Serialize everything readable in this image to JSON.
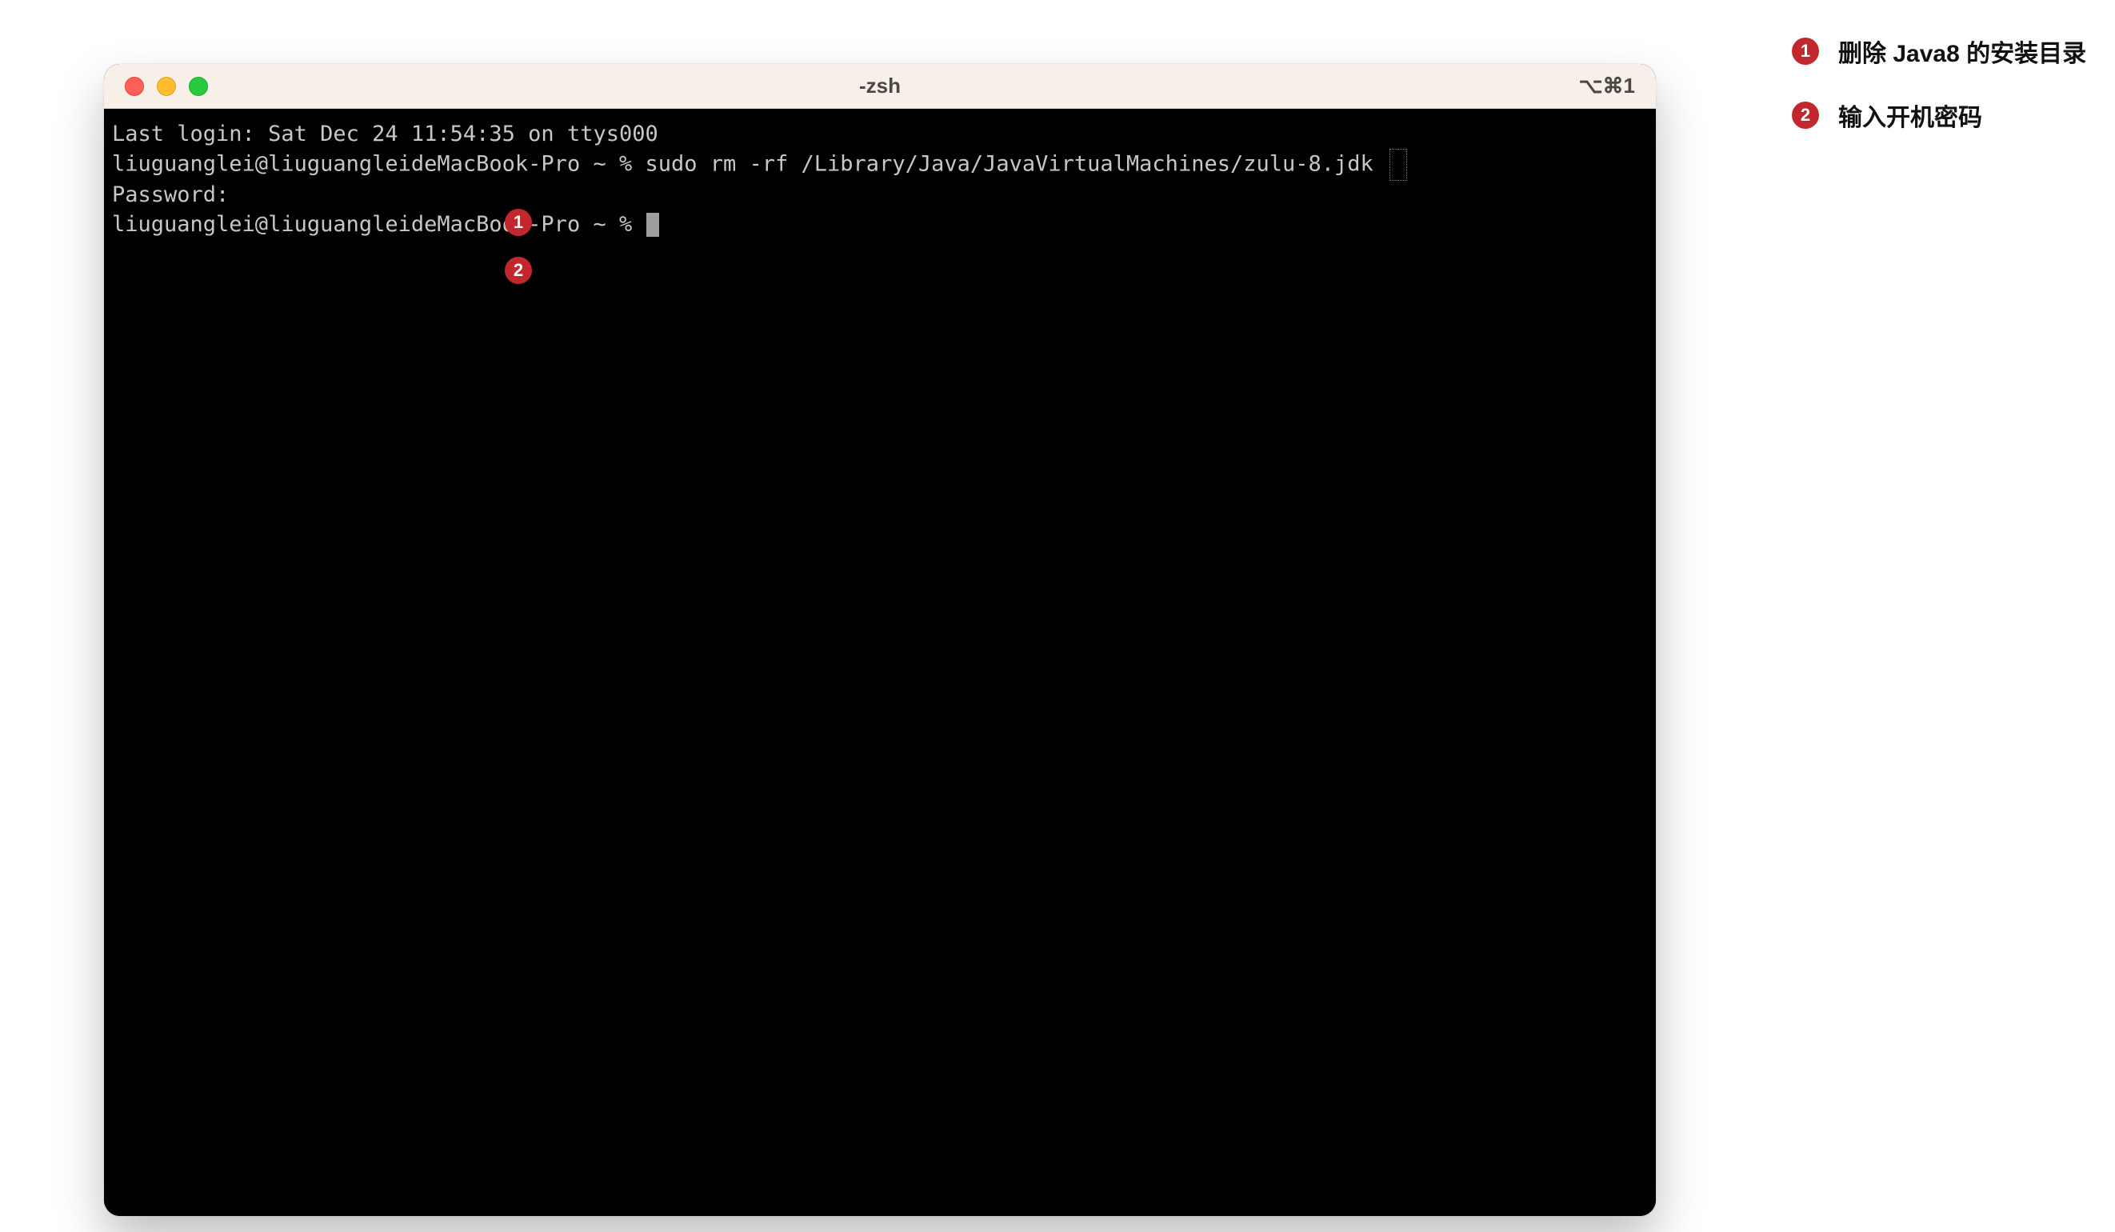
{
  "window": {
    "title": "-zsh",
    "shortcut": "⌥⌘1"
  },
  "terminal": {
    "line1": "Last login: Sat Dec 24 11:54:35 on ttys000",
    "line2": "liuguanglei@liuguangleideMacBook-Pro ~ % sudo rm -rf /Library/Java/JavaVirtualMachines/zulu-8.jdk ",
    "line3": "Password:",
    "line4": "liuguanglei@liuguangleideMacBook-Pro ~ % "
  },
  "badges": {
    "b1": "1",
    "b2": "2"
  },
  "legend": {
    "items": [
      {
        "num": "1",
        "text": "删除 Java8 的安装目录"
      },
      {
        "num": "2",
        "text": "输入开机密码"
      }
    ]
  }
}
